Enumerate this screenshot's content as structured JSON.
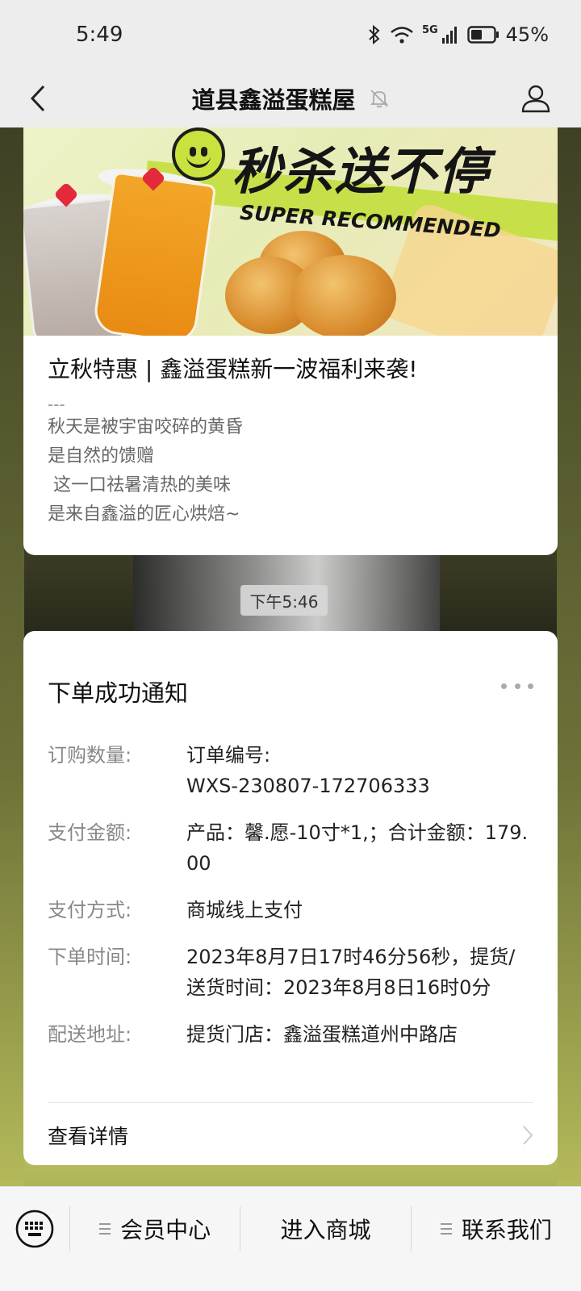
{
  "status_bar": {
    "time": "5:49",
    "battery_percent": "45%",
    "network_label": "5G"
  },
  "header": {
    "title": "道县鑫溢蛋糕屋"
  },
  "article": {
    "banner": {
      "headline": "秒杀送不停",
      "subline": "SUPER RECOMMENDED"
    },
    "title": "立秋特惠 | 鑫溢蛋糕新一波福利来袭!",
    "separator": "---",
    "lines": [
      "秋天是被宇宙咬碎的黄昏",
      "是自然的馈赠",
      " 这一口祛暑清热的美味",
      "是来自鑫溢的匠心烘焙~"
    ]
  },
  "timestamp": "下午5:46",
  "notice": {
    "title": "下单成功通知",
    "rows": [
      {
        "label": "订购数量:",
        "value": "订单编号:\nWXS-230807-172706333"
      },
      {
        "label": "支付金额:",
        "value": "产品：馨.愿-10寸*1,；合计金额：179.00"
      },
      {
        "label": "支付方式:",
        "value": "商城线上支付"
      },
      {
        "label": "下单时间:",
        "value": "2023年8月7日17时46分56秒，提货/送货时间：2023年8月8日16时0分"
      },
      {
        "label": "配送地址:",
        "value": "提货门店：鑫溢蛋糕道州中路店"
      }
    ],
    "detail_label": "查看详情"
  },
  "bottom_menu": {
    "items": [
      {
        "label": "会员中心",
        "has_submenu": true
      },
      {
        "label": "进入商城",
        "has_submenu": false
      },
      {
        "label": "联系我们",
        "has_submenu": true
      }
    ]
  },
  "colors": {
    "bar_bg": "#ededed",
    "card_bg": "#ffffff",
    "label_gray": "#888888",
    "banner_green": "#c7e04a"
  },
  "icons": {
    "back": "chevron-left-icon",
    "mute": "bell-off-icon",
    "profile": "person-icon",
    "keyboard": "keyboard-icon",
    "more": "more-dots-icon",
    "detail": "chevron-right-icon"
  }
}
